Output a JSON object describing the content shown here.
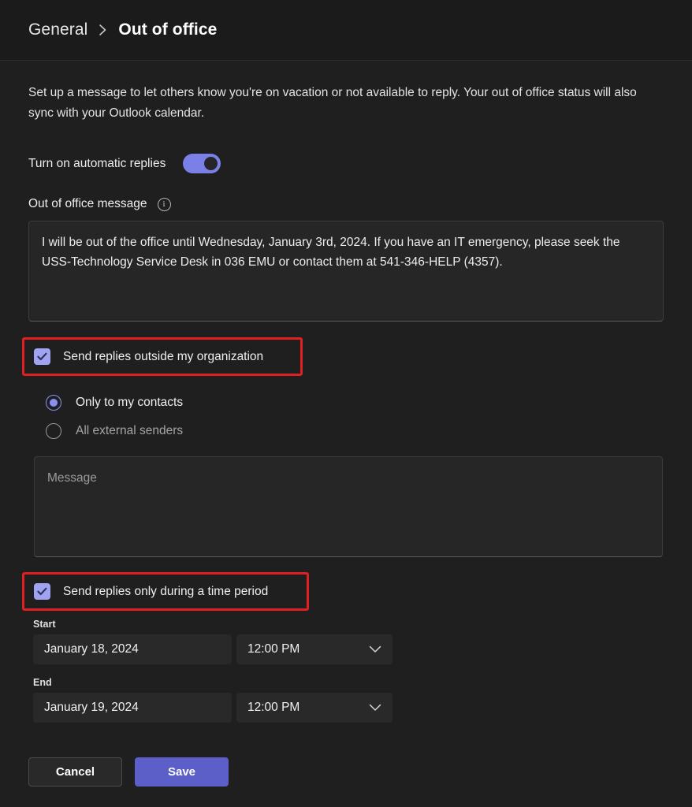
{
  "header": {
    "breadcrumb_parent": "General",
    "breadcrumb_separator": "›",
    "breadcrumb_current": "Out of office"
  },
  "main": {
    "intro": "Set up a message to let others know you're on vacation or not available to reply. Your out of office status will also sync with your Outlook calendar.",
    "automatic_replies": {
      "label": "Turn on automatic replies",
      "state": "on"
    },
    "oof_message": {
      "label": "Out of office message",
      "info_glyph": "i",
      "value": "I will be out of the office until Wednesday, January 3rd, 2024. If you have an IT emergency, please seek the USS-Technology Service Desk in 036 EMU or contact them at 541-346-HELP (4357)."
    },
    "outside_org": {
      "label": "Send replies outside my organization",
      "checked": true,
      "highlighted": true,
      "options": [
        {
          "label": "Only to my contacts",
          "selected": true
        },
        {
          "label": "All external senders",
          "selected": false
        }
      ],
      "external_message_placeholder": "Message",
      "external_message_value": ""
    },
    "time_period": {
      "label": "Send replies only during a time period",
      "checked": true,
      "highlighted": true,
      "start": {
        "caption": "Start",
        "date": "January 18, 2024",
        "time": "12:00 PM"
      },
      "end": {
        "caption": "End",
        "date": "January 19, 2024",
        "time": "12:00 PM"
      }
    }
  },
  "actions": {
    "cancel_label": "Cancel",
    "save_label": "Save"
  },
  "colors": {
    "background": "#1f1f1f",
    "header_background": "#1b1b1b",
    "accent_primary": "#5b5fc7",
    "accent_control": "#7b80e8",
    "highlight_annotation": "#e02020",
    "field_background": "#262626",
    "text_primary": "#f0f0f0",
    "text_muted": "#a5a5a5"
  }
}
